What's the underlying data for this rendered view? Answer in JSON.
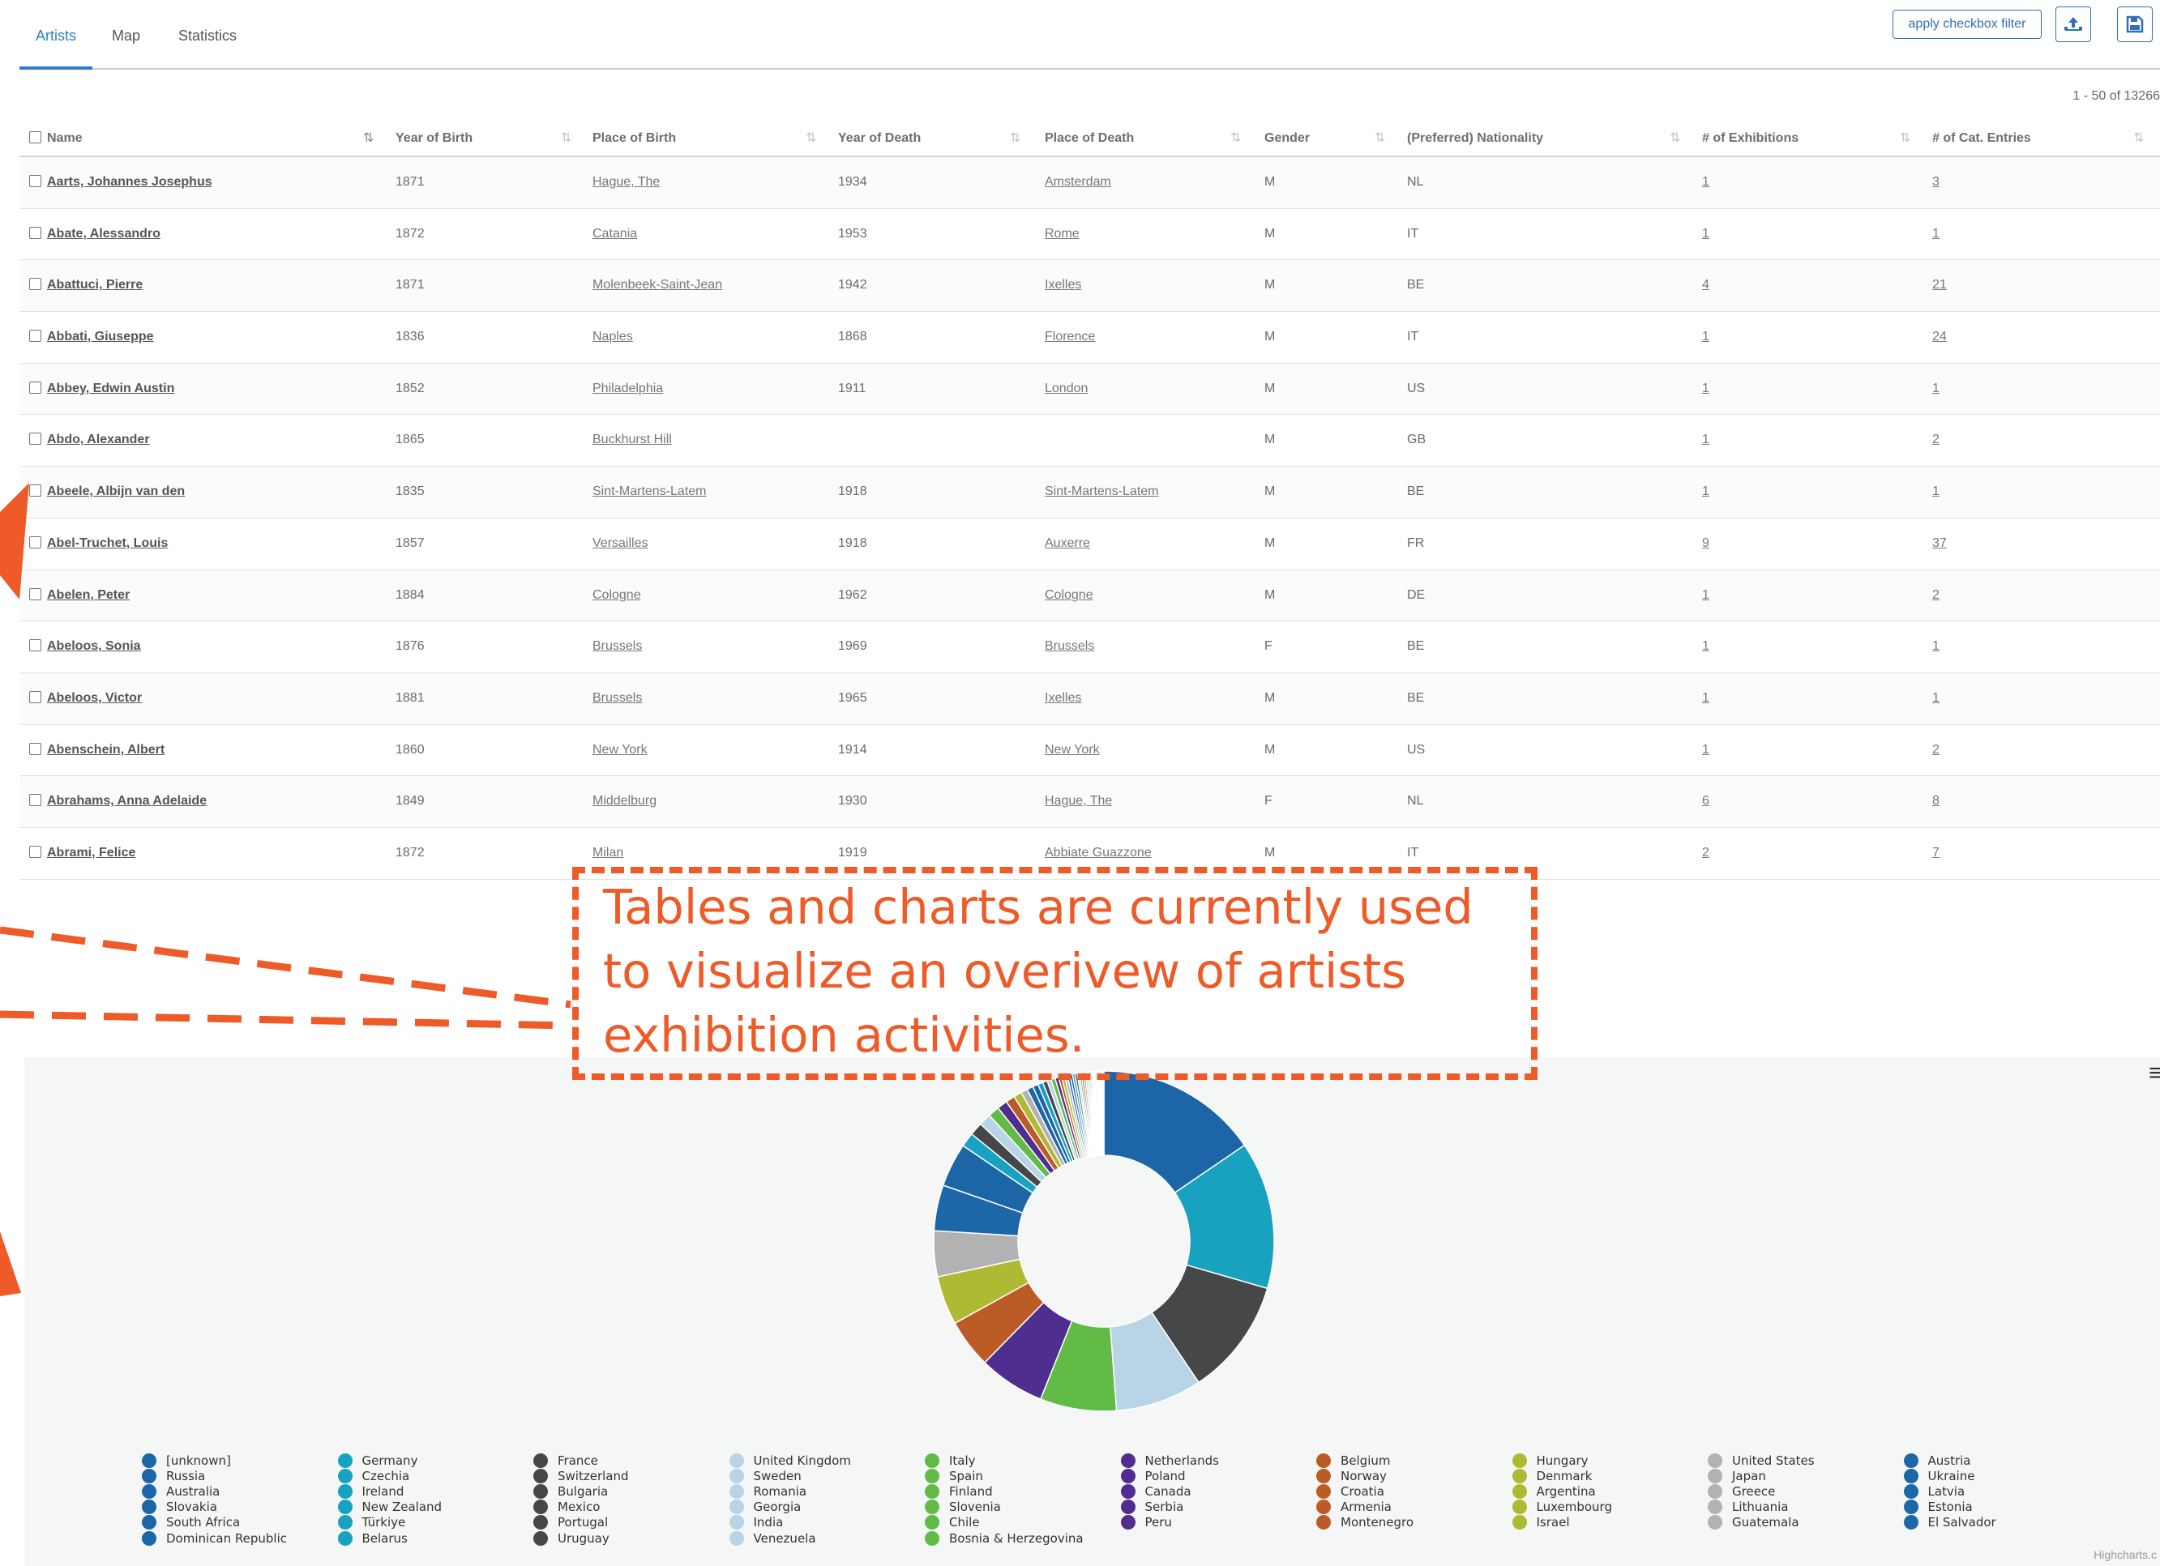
{
  "tabs": [
    {
      "label": "Artists",
      "active": true
    },
    {
      "label": "Map",
      "active": false
    },
    {
      "label": "Statistics",
      "active": false
    }
  ],
  "toolbar": {
    "apply_filter_label": "apply checkbox filter",
    "upload_icon": "cloud-upload-icon",
    "save_icon": "save-icon"
  },
  "pagination": {
    "range_text": "1 - 50 of 13266"
  },
  "table": {
    "columns": [
      "Name",
      "Year of Birth",
      "Place of Birth",
      "Year of Death",
      "Place of Death",
      "Gender",
      "(Preferred) Nationality",
      "# of Exhibitions",
      "# of Cat. Entries"
    ],
    "rows": [
      {
        "name": "Aarts, Johannes Josephus",
        "birth_year": "1871",
        "birth_place": "Hague, The",
        "death_year": "1934",
        "death_place": "Amsterdam",
        "gender": "M",
        "nationality": "NL",
        "exhibitions": "1",
        "entries": "3"
      },
      {
        "name": "Abate, Alessandro",
        "birth_year": "1872",
        "birth_place": "Catania",
        "death_year": "1953",
        "death_place": "Rome",
        "gender": "M",
        "nationality": "IT",
        "exhibitions": "1",
        "entries": "1"
      },
      {
        "name": "Abattuci, Pierre",
        "birth_year": "1871",
        "birth_place": "Molenbeek-Saint-Jean",
        "death_year": "1942",
        "death_place": "Ixelles",
        "gender": "M",
        "nationality": "BE",
        "exhibitions": "4",
        "entries": "21"
      },
      {
        "name": "Abbati, Giuseppe",
        "birth_year": "1836",
        "birth_place": "Naples",
        "death_year": "1868",
        "death_place": "Florence",
        "gender": "M",
        "nationality": "IT",
        "exhibitions": "1",
        "entries": "24"
      },
      {
        "name": "Abbey, Edwin Austin",
        "birth_year": "1852",
        "birth_place": "Philadelphia",
        "death_year": "1911",
        "death_place": "London",
        "gender": "M",
        "nationality": "US",
        "exhibitions": "1",
        "entries": "1"
      },
      {
        "name": "Abdo, Alexander",
        "birth_year": "1865",
        "birth_place": "Buckhurst Hill",
        "death_year": "",
        "death_place": "",
        "gender": "M",
        "nationality": "GB",
        "exhibitions": "1",
        "entries": "2"
      },
      {
        "name": "Abeele, Albijn van den",
        "birth_year": "1835",
        "birth_place": "Sint-Martens-Latem",
        "death_year": "1918",
        "death_place": "Sint-Martens-Latem",
        "gender": "M",
        "nationality": "BE",
        "exhibitions": "1",
        "entries": "1"
      },
      {
        "name": "Abel-Truchet, Louis",
        "birth_year": "1857",
        "birth_place": "Versailles",
        "death_year": "1918",
        "death_place": "Auxerre",
        "gender": "M",
        "nationality": "FR",
        "exhibitions": "9",
        "entries": "37"
      },
      {
        "name": "Abelen, Peter",
        "birth_year": "1884",
        "birth_place": "Cologne",
        "death_year": "1962",
        "death_place": "Cologne",
        "gender": "M",
        "nationality": "DE",
        "exhibitions": "1",
        "entries": "2"
      },
      {
        "name": "Abeloos, Sonia",
        "birth_year": "1876",
        "birth_place": "Brussels",
        "death_year": "1969",
        "death_place": "Brussels",
        "gender": "F",
        "nationality": "BE",
        "exhibitions": "1",
        "entries": "1"
      },
      {
        "name": "Abeloos, Victor",
        "birth_year": "1881",
        "birth_place": "Brussels",
        "death_year": "1965",
        "death_place": "Ixelles",
        "gender": "M",
        "nationality": "BE",
        "exhibitions": "1",
        "entries": "1"
      },
      {
        "name": "Abenschein, Albert",
        "birth_year": "1860",
        "birth_place": "New York",
        "death_year": "1914",
        "death_place": "New York",
        "gender": "M",
        "nationality": "US",
        "exhibitions": "1",
        "entries": "2"
      },
      {
        "name": "Abrahams, Anna Adelaide",
        "birth_year": "1849",
        "birth_place": "Middelburg",
        "death_year": "1930",
        "death_place": "Hague, The",
        "gender": "F",
        "nationality": "NL",
        "exhibitions": "6",
        "entries": "8"
      },
      {
        "name": "Abrami, Felice",
        "birth_year": "1872",
        "birth_place": "Milan",
        "death_year": "1919",
        "death_place": "Abbiate Guazzone",
        "gender": "M",
        "nationality": "IT",
        "exhibitions": "2",
        "entries": "7"
      }
    ]
  },
  "annotation": {
    "text": "Tables and charts are currently used to visualize an overivew of artists exhibition activities.",
    "color": "#ee5a28"
  },
  "chart_menu_icon": "hamburger-menu-icon",
  "credits": "Highcharts.c",
  "chart_data": {
    "type": "pie",
    "donut": true,
    "categories": [
      "[unknown]",
      "Germany",
      "France",
      "United Kingdom",
      "Italy",
      "Netherlands",
      "Belgium",
      "Hungary",
      "United States",
      "Austria",
      "Russia",
      "Czechia",
      "Switzerland",
      "Sweden",
      "Spain",
      "Poland",
      "Norway",
      "Denmark",
      "Japan",
      "Ukraine",
      "Australia",
      "Ireland",
      "Bulgaria",
      "Romania",
      "Finland",
      "Canada",
      "Croatia",
      "Argentina",
      "Greece",
      "Latvia",
      "Slovakia",
      "New Zealand",
      "Mexico",
      "Georgia",
      "Slovenia",
      "Serbia",
      "Armenia",
      "Luxembourg",
      "Lithuania",
      "Estonia",
      "South Africa",
      "Türkiye",
      "Portugal",
      "India",
      "Chile",
      "Peru",
      "Montenegro",
      "Israel",
      "Guatemala",
      "El Salvador",
      "Dominican Republic",
      "Belarus",
      "Uruguay",
      "Venezuela",
      "Bosnia & Herzegovina"
    ],
    "values": [
      16.0,
      14.5,
      11.5,
      8.5,
      7.5,
      6.5,
      4.8,
      4.8,
      4.5,
      4.5,
      4.3,
      1.4,
      1.3,
      1.2,
      1.1,
      1.0,
      0.9,
      0.8,
      0.65,
      0.6,
      0.55,
      0.5,
      0.45,
      0.4,
      0.4,
      0.35,
      0.3,
      0.3,
      0.28,
      0.26,
      0.25,
      0.24,
      0.22,
      0.2,
      0.2,
      0.19,
      0.18,
      0.17,
      0.16,
      0.15,
      0.14,
      0.13,
      0.12,
      0.11,
      0.1,
      0.1,
      0.09,
      0.09,
      0.08,
      0.08,
      0.07,
      0.07,
      0.06,
      0.06,
      0.05
    ],
    "colors": [
      "#1c66a8",
      "#18a2c0",
      "#454748",
      "#b8d4e6",
      "#61bb46",
      "#4f2e8f",
      "#bb5c26",
      "#afba33",
      "#b2b2b2",
      "#1d66a8"
    ],
    "legend": "bottom"
  }
}
